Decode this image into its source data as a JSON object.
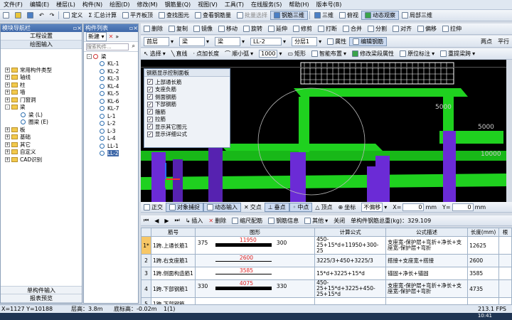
{
  "menu": [
    "文件(F)",
    "编辑(E)",
    "楼层(L)",
    "构件(N)",
    "绘图(D)",
    "修改(M)",
    "钢筋量(Q)",
    "视图(V)",
    "工具(T)",
    "在线服务(S)",
    "帮助(H)",
    "版本号(B)"
  ],
  "toolbar1": {
    "define": "定义",
    "sum": "Σ 汇总计算",
    "align": "平齐板顶",
    "find": "查找图元",
    "view_qty": "查看钢筋量",
    "batch": "批量选择",
    "rebar3d": "钢筋三维",
    "view3d": "三维",
    "plan": "俯视",
    "dynamic": "动态观察",
    "partial": "局部三维"
  },
  "toolbar2": {
    "delete": "删除",
    "copy": "复制",
    "mirror": "镜像",
    "move": "移动",
    "rotate": "旋转",
    "extend": "延伸",
    "trim": "修剪",
    "break": "打断",
    "merge": "合并",
    "split": "分割",
    "align": "对齐",
    "offset": "偏移",
    "stretch": "拉伸"
  },
  "toolbar3": {
    "floor": "首层",
    "type": "梁",
    "subtype": "梁",
    "name": "LL-2",
    "layer": "分层1",
    "props": "属性",
    "edit_rebar": "编辑钢筋",
    "two_point": "两点",
    "parallel": "平行"
  },
  "toolbar4": {
    "select": "选择",
    "line": "直线",
    "add_len": "点加长度",
    "arc": "顺小弧",
    "radius": "1000",
    "rect": "矩形",
    "smart": "智能布置",
    "modify_span": "修改梁段属性",
    "origin": "原位标注",
    "relabel": "重提梁跨"
  },
  "nav": {
    "title": "模块导航栏",
    "project_setup": "工程设置",
    "draw_input": "绘图输入",
    "items": [
      {
        "label": "常用构件类型",
        "exp": "+"
      },
      {
        "label": "轴线",
        "exp": "+"
      },
      {
        "label": "柱",
        "exp": "+"
      },
      {
        "label": "墙",
        "exp": "+"
      },
      {
        "label": "门窗洞",
        "exp": "+"
      },
      {
        "label": "梁",
        "exp": "-"
      },
      {
        "label": "梁 (L)",
        "sub": true
      },
      {
        "label": "圈梁 (E)",
        "sub": true
      },
      {
        "label": "板",
        "exp": "+"
      },
      {
        "label": "基础",
        "exp": "+"
      },
      {
        "label": "其它",
        "exp": "+"
      },
      {
        "label": "自定义",
        "exp": "+"
      },
      {
        "label": "CAD识别",
        "exp": "+"
      }
    ],
    "single_input": "单构件输入",
    "report": "报表预览"
  },
  "comp_list": {
    "title": "构件列表",
    "new": "新建",
    "search_placeholder": "搜索构件...",
    "root": "梁",
    "items": [
      "KL-1",
      "KL-2",
      "KL-3",
      "KL-4",
      "KL-5",
      "KL-6",
      "KL-7",
      "L-1",
      "L-2",
      "L-3",
      "L-4",
      "LL-1",
      "LL-2"
    ],
    "selected": "LL-2"
  },
  "rebar_panel": {
    "title": "钢筋显示控制面板",
    "items": [
      "上部通长筋",
      "支座负筋",
      "侧面钢筋",
      "下部钢筋",
      "箍筋",
      "拉筋",
      "显示其它图元",
      "显示详细公式"
    ]
  },
  "viewport": {
    "dim1": "5000",
    "dim2": "5000",
    "dim3": "10000"
  },
  "snap": {
    "ortho": "正交",
    "snap": "对象捕捉",
    "dyn": "动态输入",
    "cross": "交点",
    "vertical": "垂点",
    "mid": "中点",
    "top": "顶点",
    "coord": "坐标",
    "no_offset": "不偏移",
    "x": "X=",
    "x_val": "0",
    "mm": "mm",
    "y": "Y=",
    "y_val": "0",
    "mm2": "mm"
  },
  "rebar_toolbar": {
    "insert": "插入",
    "delete": "删除",
    "scale": "缩尺配筋",
    "info": "钢筋信息",
    "other": "其他",
    "close": "关闭",
    "weight": "单构件钢筋总重(kg)：329.109"
  },
  "table": {
    "headers": [
      "",
      "筋号",
      "图形",
      "计算公式",
      "公式描述",
      "长度(mm)",
      "根"
    ],
    "rows": [
      {
        "no": "1*",
        "name": "1跨.上通长筋1",
        "left": "375",
        "mid": "11950",
        "right": "300",
        "formula": "450-25+15*d+11950+300-25",
        "desc": "支座宽-保护层+弯折+净长+支座宽-保护层+弯折",
        "len": "12625"
      },
      {
        "no": "2",
        "name": "1跨.右支座筋1",
        "left": "",
        "mid": "2600",
        "right": "",
        "formula": "3225/3+450+3225/3",
        "desc": "搭接+支座宽+搭接",
        "len": "2600"
      },
      {
        "no": "3",
        "name": "1跨.侧面构造筋1",
        "left": "",
        "mid": "3585",
        "right": "",
        "formula": "15*d+3225+15*d",
        "desc": "锚固+净长+锚固",
        "len": "3585"
      },
      {
        "no": "4",
        "name": "1跨.下部钢筋1",
        "left": "330",
        "mid": "4075",
        "right": "330",
        "formula": "450-25+15*d+3225+450-25+15*d",
        "desc": "支座宽-保护层+弯折+净长+支座宽-保护层+弯折",
        "len": "4735"
      },
      {
        "no": "5",
        "name": "1跨.下部钢筋",
        "left": "",
        "mid": "",
        "right": "",
        "formula": "",
        "desc": "",
        "len": ""
      }
    ]
  },
  "status": {
    "coords": "X=1127 Y=10188",
    "floor_h": "层高：3.8m",
    "base_h": "底标高：-0.02m",
    "count": "1(1)",
    "fps": "213.1 FPS"
  },
  "taskbar": {
    "time": "10:41"
  },
  "colors": {
    "beam_green": "#1fd11f",
    "column_purple": "#6b2bd6",
    "axis_red": "#ff2a2a",
    "axis_blue": "#2a6aff",
    "rebar_white": "#ffffff"
  }
}
